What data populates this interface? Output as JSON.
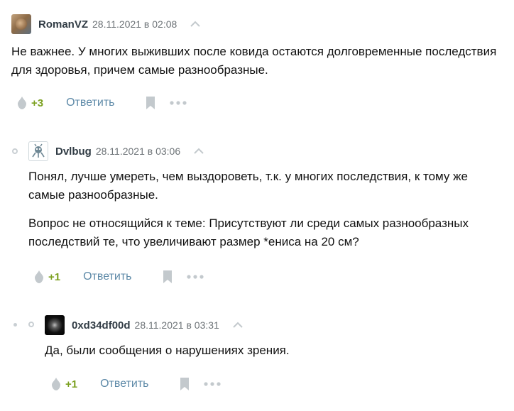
{
  "comments": [
    {
      "username": "RomanVZ",
      "date": "28.11.2021 в 02:08",
      "paragraphs": [
        "Не важнее. У многих выживших после ковида остаются долговременные последствия для здоровья, причем самые разнообразные."
      ],
      "score": "+3",
      "reply_label": "Ответить"
    },
    {
      "username": "Dvlbug",
      "date": "28.11.2021 в 03:06",
      "paragraphs": [
        "Понял, лучше умереть, чем выздороветь, т.к. у многих последствия, к тому же самые разнообразные.",
        "Вопрос не относящийся к теме: Присутствуют ли среди самых разнообразных последствий те, что увеличивают размер *ениса на 20 см?"
      ],
      "score": "+1",
      "reply_label": "Ответить"
    },
    {
      "username": "0xd34df00d",
      "date": "28.11.2021 в 03:31",
      "paragraphs": [
        "Да, были сообщения о нарушениях зрения."
      ],
      "score": "+1",
      "reply_label": "Ответить"
    }
  ],
  "colors": {
    "score": "#7ba01f",
    "reply_link": "#5e8aa8",
    "icon_gray": "#c3c9cd",
    "username": "#303b44",
    "date": "#6d7377"
  },
  "icons": {
    "vote": "diamond-vote-icon",
    "bookmark": "bookmark-icon",
    "more": "more-icon",
    "parent": "up-arrow-icon"
  }
}
